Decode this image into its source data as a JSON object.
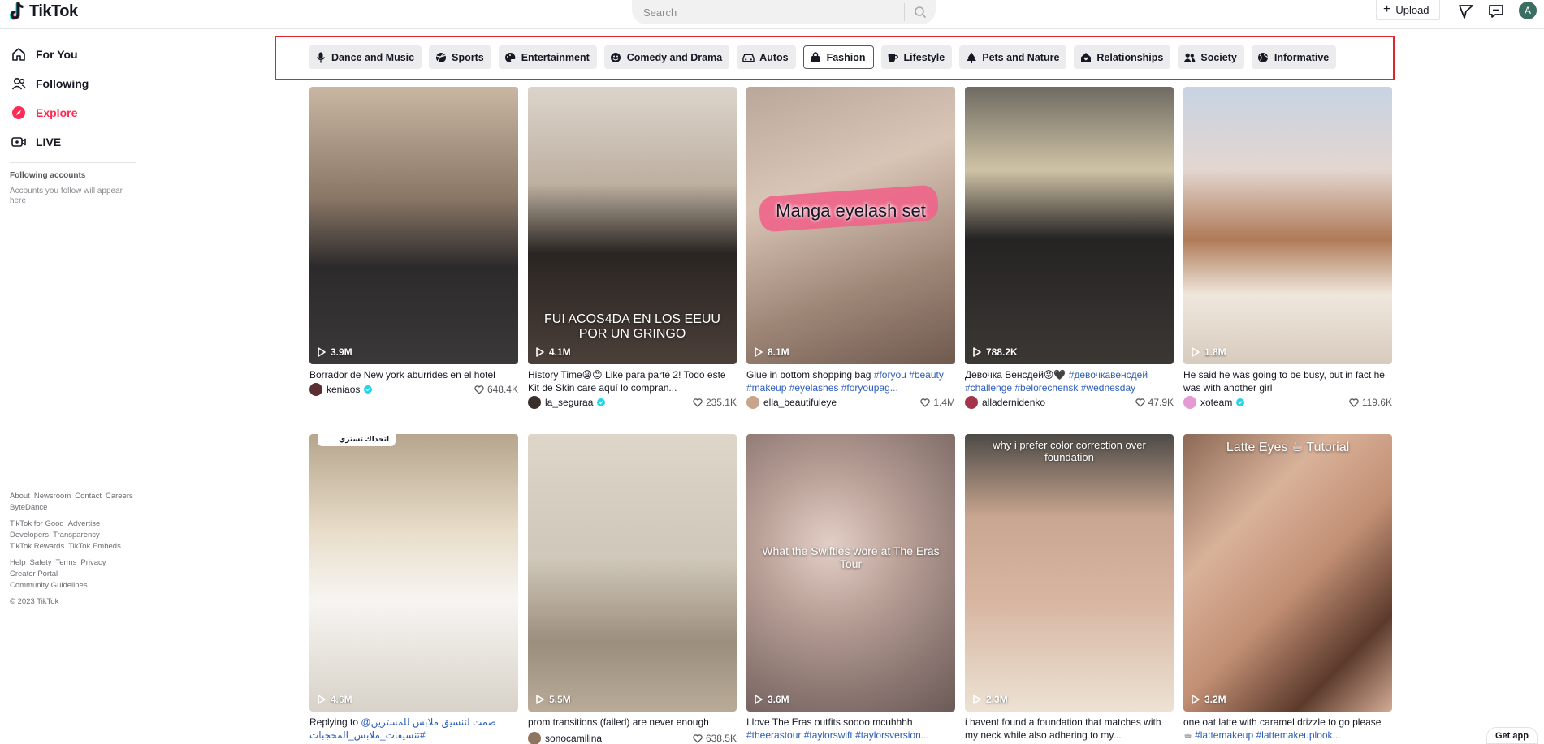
{
  "header": {
    "brand": "TikTok",
    "search_placeholder": "Search",
    "upload_label": "Upload",
    "avatar_initial": "A"
  },
  "sidebar": {
    "nav": [
      {
        "label": "For You",
        "icon": "home-icon"
      },
      {
        "label": "Following",
        "icon": "following-icon"
      },
      {
        "label": "Explore",
        "icon": "explore-icon"
      },
      {
        "label": "LIVE",
        "icon": "live-icon"
      }
    ],
    "following_title": "Following accounts",
    "following_text": "Accounts you follow will appear here",
    "footer": {
      "row1": [
        "About",
        "Newsroom",
        "Contact",
        "Careers"
      ],
      "row1b": [
        "ByteDance"
      ],
      "row2": [
        "TikTok for Good",
        "Advertise"
      ],
      "row3": [
        "Developers",
        "Transparency"
      ],
      "row4": [
        "TikTok Rewards",
        "TikTok Embeds"
      ],
      "row5": [
        "Help",
        "Safety",
        "Terms",
        "Privacy"
      ],
      "row6": [
        "Creator Portal"
      ],
      "row7": [
        "Community Guidelines"
      ],
      "copyright": "© 2023 TikTok"
    }
  },
  "categories": [
    {
      "label": "Dance and Music",
      "icon": "microphone-icon"
    },
    {
      "label": "Sports",
      "icon": "sports-icon"
    },
    {
      "label": "Entertainment",
      "icon": "palette-icon"
    },
    {
      "label": "Comedy and Drama",
      "icon": "comedy-mask-icon"
    },
    {
      "label": "Autos",
      "icon": "car-icon"
    },
    {
      "label": "Fashion",
      "icon": "bag-icon",
      "active": true
    },
    {
      "label": "Lifestyle",
      "icon": "cup-icon"
    },
    {
      "label": "Pets and Nature",
      "icon": "tree-icon"
    },
    {
      "label": "Relationships",
      "icon": "home-heart-icon"
    },
    {
      "label": "Society",
      "icon": "people-icon"
    },
    {
      "label": "Informative",
      "icon": "globe-icon"
    }
  ],
  "videos": [
    {
      "views": "3.9M",
      "desc": "Borrador de New york aburrides en el hotel",
      "tags": "",
      "author": "keniaos",
      "verified": true,
      "likes": "648.4K",
      "overlay": ""
    },
    {
      "views": "4.1M",
      "desc": "History Time😩😊 Like para parte 2! Todo este Kit de Skin care aquí lo compran...",
      "tags": "",
      "author": "la_seguraa",
      "verified": true,
      "likes": "235.1K",
      "overlay": "FUI ACOS4DA EN LOS EEUU POR UN GRINGO"
    },
    {
      "views": "8.1M",
      "desc": "Glue in bottom shopping bag ",
      "tags": "#foryou #beauty #makeup #eyelashes #foryoupag...",
      "author": "ella_beautifuleye",
      "verified": false,
      "likes": "1.4M",
      "overlay": "Manga eyelash set"
    },
    {
      "views": "788.2K",
      "desc": "Девочка Венсдей😜🖤 ",
      "tags": "#девочкавенсдей #challenge #belorechensk #wednesday",
      "author": "alladernidenko",
      "verified": false,
      "likes": "47.9K",
      "overlay": ""
    },
    {
      "views": "1.8M",
      "desc": "He said he was going to be busy, but in fact he was with another girl",
      "tags": "",
      "author": "xoteam",
      "verified": true,
      "likes": "119.6K",
      "overlay": ""
    },
    {
      "views": "4.6M",
      "desc": "Replying to ",
      "tags": "@صمت لتنسيق ملابس للمسترين #تنسيقات_ملابس_المحجبات",
      "author": "",
      "verified": false,
      "likes": "",
      "overlay": "اتحداك تستري"
    },
    {
      "views": "5.5M",
      "desc": "prom transitions (failed) are never enough",
      "tags": "",
      "author": "sonocamilina",
      "verified": false,
      "likes": "638.5K",
      "overlay": ""
    },
    {
      "views": "3.6M",
      "desc": "I love The Eras outfits soooo mcuhhhh ",
      "tags": "#theerastour #taylorswift #taylorsversion...",
      "author": "",
      "verified": false,
      "likes": "",
      "overlay": "What the Swifties wore at The Eras Tour"
    },
    {
      "views": "2.3M",
      "desc": "i havent found a foundation that matches with my neck while also adhering to my...",
      "tags": "",
      "author": "",
      "verified": false,
      "likes": "",
      "overlay": "why i prefer color correction over foundation"
    },
    {
      "views": "3.2M",
      "desc": "one oat latte with caramel drizzle to go please ☕ ",
      "tags": "#lattemakeup #lattemakeuplook...",
      "author": "",
      "verified": false,
      "likes": "",
      "overlay": "Latte Eyes ☕ Tutorial"
    }
  ],
  "get_app": "Get app",
  "colors": {
    "accent": "#fe2c55",
    "highlight_box": "#e0252e",
    "hashtag": "#2b5db9"
  }
}
